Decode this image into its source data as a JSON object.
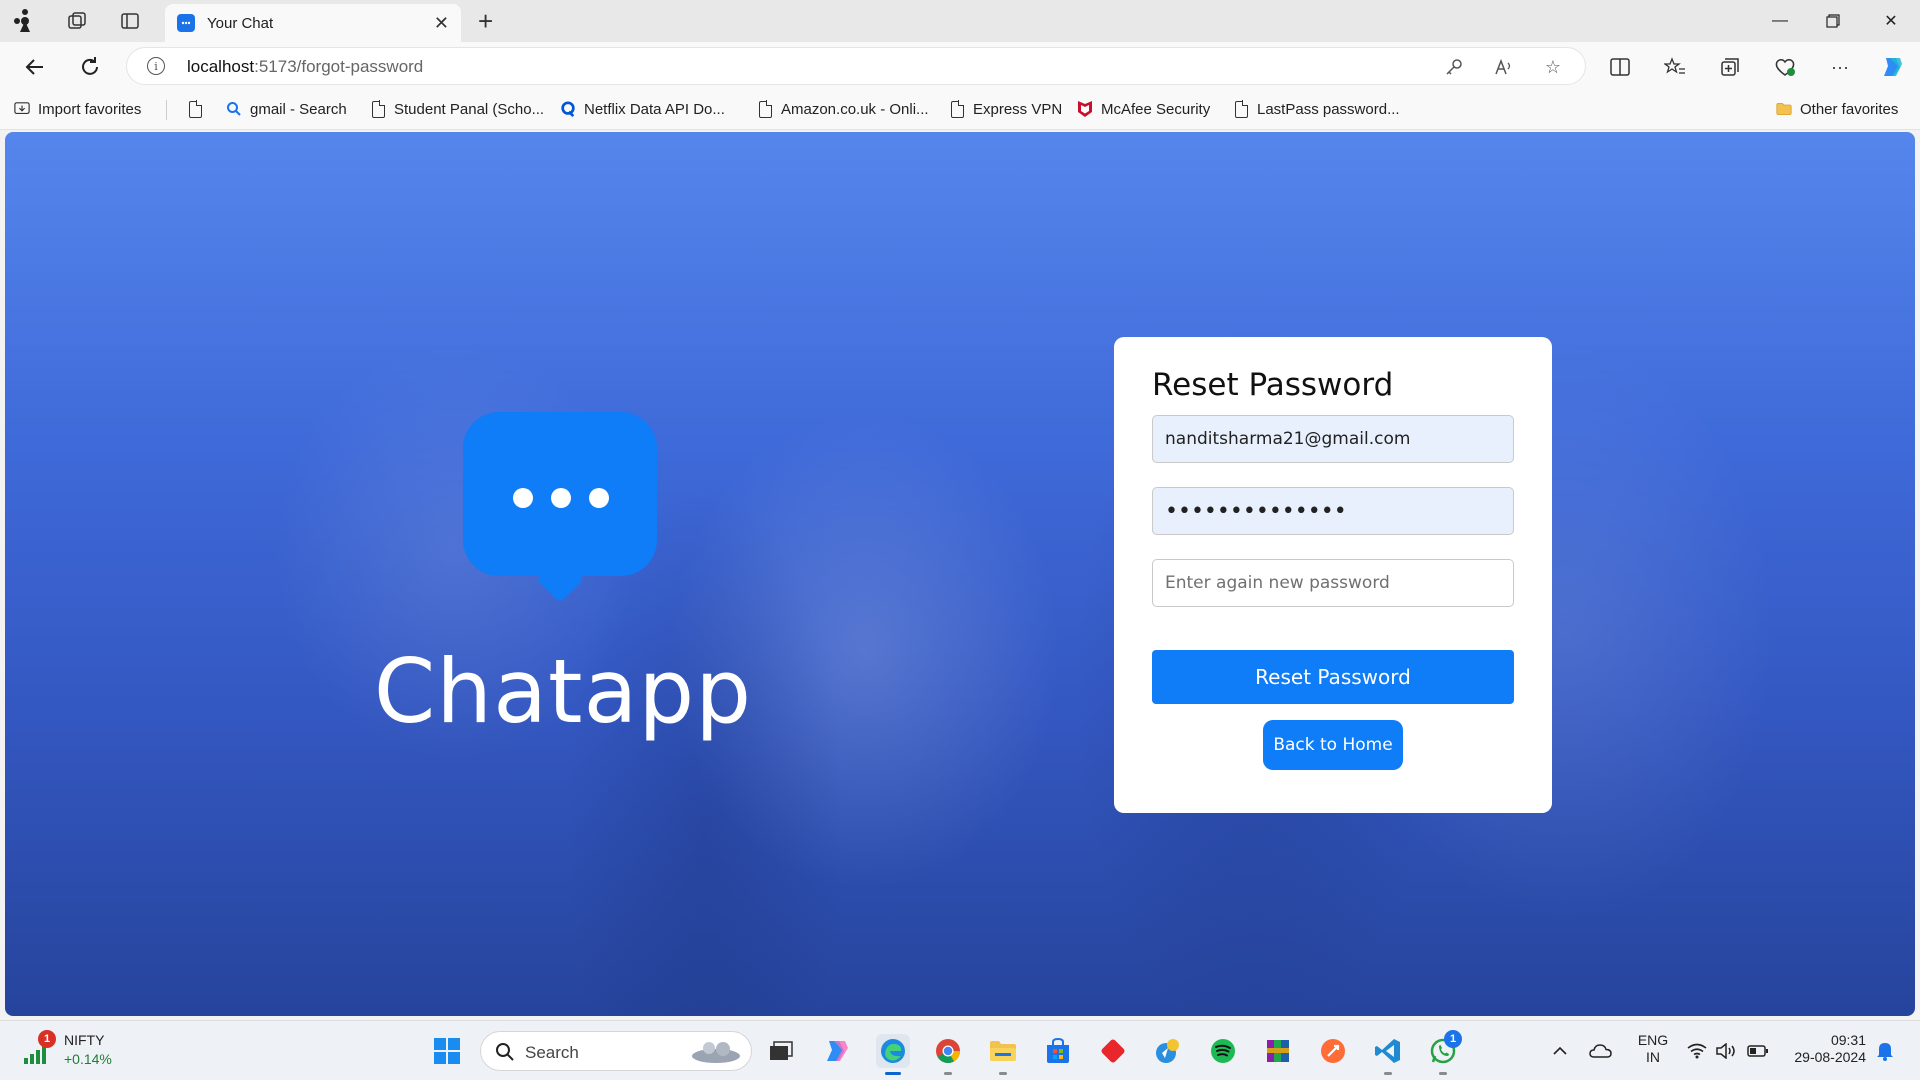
{
  "browser": {
    "tab_title": "Your Chat",
    "url_host": "localhost",
    "url_path": ":5173/forgot-password"
  },
  "favorites": {
    "items": [
      {
        "label": "Import favorites",
        "icon": "import-icon"
      },
      {
        "label": "",
        "icon": "page-icon"
      },
      {
        "label": "gmail - Search",
        "icon": "search-icon"
      },
      {
        "label": "Student Panal (Scho...",
        "icon": "page-icon"
      },
      {
        "label": "Netflix Data API Do...",
        "icon": "rapidapi-icon"
      },
      {
        "label": "Amazon.co.uk - Onli...",
        "icon": "page-icon"
      },
      {
        "label": "Express VPN",
        "icon": "page-icon"
      },
      {
        "label": "McAfee Security",
        "icon": "mcafee-icon"
      },
      {
        "label": "LastPass password...",
        "icon": "page-icon"
      }
    ],
    "other_label": "Other favorites"
  },
  "app": {
    "brand_name": "Chatapp",
    "card": {
      "title": "Reset Password",
      "email_value": "nanditsharma21@gmail.com",
      "password_masked": "••••••••••••••",
      "confirm_placeholder": "Enter again new password",
      "submit_label": "Reset Password",
      "home_label": "Back to Home"
    },
    "colors": {
      "accent": "#0f7cf8",
      "background_top": "#5586ec",
      "background_bottom": "#26449c"
    }
  },
  "taskbar": {
    "widget_label": "NIFTY",
    "widget_value": "+0.14%",
    "widget_badge": "1",
    "search_label": "Search",
    "whatsapp_badge": "1",
    "lang_line1": "ENG",
    "lang_line2": "IN",
    "time": "09:31",
    "date": "29-08-2024"
  }
}
